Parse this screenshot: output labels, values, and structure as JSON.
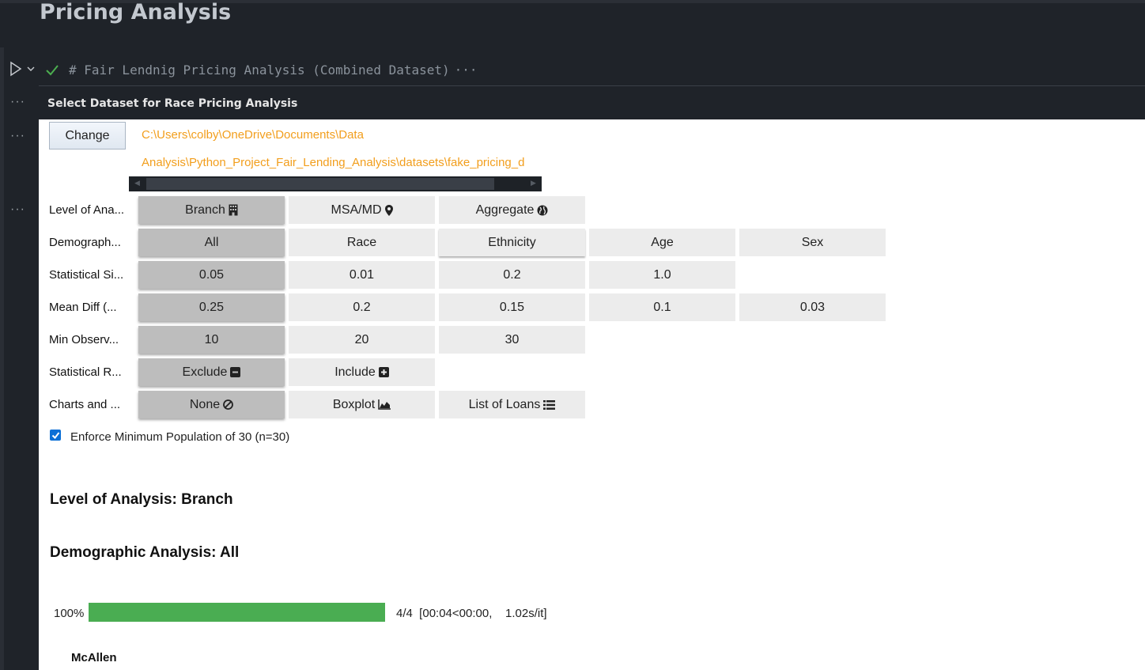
{
  "notebook": {
    "title": "Pricing Analysis",
    "code_cell": {
      "code_text": "# Fair Lendnig Pricing Analysis (Combined Dataset)",
      "ellipsis": "···",
      "status": "success"
    },
    "gutter_dots": "···"
  },
  "output": {
    "header": "Select Dataset for Race Pricing Analysis",
    "change_button": "Change",
    "path_line1": "C:\\Users\\colby\\OneDrive\\Documents\\Data",
    "path_line2": "Analysis\\Python_Project_Fair_Lending_Analysis\\datasets\\fake_pricing_d",
    "rows": [
      {
        "label": "Level of Ana...",
        "options": [
          "Branch",
          "MSA/MD",
          "Aggregate"
        ],
        "icons": [
          "building-icon",
          "map-marker-icon",
          "globe-icon"
        ],
        "selected": 0
      },
      {
        "label": "Demograph...",
        "options": [
          "All",
          "Race",
          "Ethnicity",
          "Age",
          "Sex"
        ],
        "selected": 0
      },
      {
        "label": "Statistical Si...",
        "options": [
          "0.05",
          "0.01",
          "0.2",
          "1.0"
        ],
        "selected": 0
      },
      {
        "label": "Mean Diff (...",
        "options": [
          "0.25",
          "0.2",
          "0.15",
          "0.1",
          "0.03"
        ],
        "selected": 0
      },
      {
        "label": "Min Observ...",
        "options": [
          "10",
          "20",
          "30"
        ],
        "selected": 0
      },
      {
        "label": "Statistical R...",
        "options": [
          "Exclude",
          "Include"
        ],
        "icons": [
          "minus-square-icon",
          "plus-square-icon"
        ],
        "selected": 0
      },
      {
        "label": "Charts and ...",
        "options": [
          "None",
          "Boxplot",
          "List of Loans"
        ],
        "icons": [
          "ban-icon",
          "area-chart-icon",
          "list-icon"
        ],
        "selected": 0
      }
    ],
    "checkbox": {
      "label": "Enforce Minimum Population of 30 (n=30)",
      "checked": true
    },
    "level_heading": "Level of Analysis: Branch",
    "demo_heading": "Demographic Analysis: All",
    "progress": {
      "percent_label": "100%",
      "fraction": 1.0,
      "stats": "4/4  [00:04<00:00,    1.02s/it]",
      "color": "#4aad52"
    },
    "group_label": "McAllen"
  }
}
